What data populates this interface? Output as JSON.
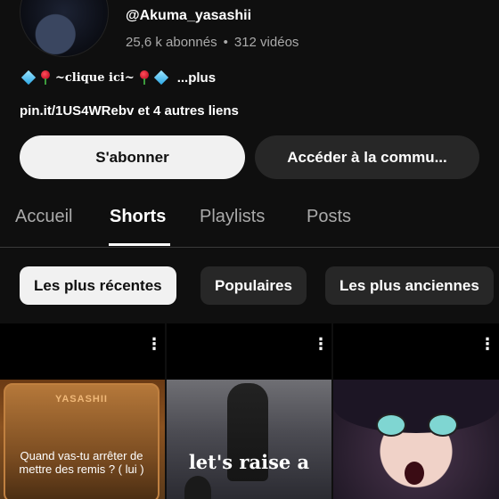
{
  "channel": {
    "handle": "@Akuma_yasashii",
    "subscribers": "25,6 k abonnés",
    "separator": "•",
    "videos": "312 vidéos",
    "bio_text": "~clique ici~",
    "bio_more": "...plus",
    "links": "pin.it/1US4WRebv et 4 autres liens"
  },
  "buttons": {
    "subscribe": "S'abonner",
    "community": "Accéder à la commu..."
  },
  "tabs": [
    {
      "label": "Accueil",
      "active": false
    },
    {
      "label": "Shorts",
      "active": true
    },
    {
      "label": "Playlists",
      "active": false
    },
    {
      "label": "Posts",
      "active": false
    }
  ],
  "filters": [
    {
      "label": "Les plus récentes",
      "active": true
    },
    {
      "label": "Populaires",
      "active": false
    },
    {
      "label": "Les plus anciennes",
      "active": false
    }
  ],
  "shorts": [
    {
      "brand": "YASASHII",
      "caption": "Quand vas-tu arrêter de mettre des remis ? ( lui )",
      "menu_icon": "⋮"
    },
    {
      "caption": "let's raise a",
      "menu_icon": "⋮"
    },
    {
      "menu_icon": "⋮"
    }
  ],
  "icons": {
    "gem": "gem-icon",
    "rose": "rose-icon",
    "more": "more-vert-icon"
  }
}
